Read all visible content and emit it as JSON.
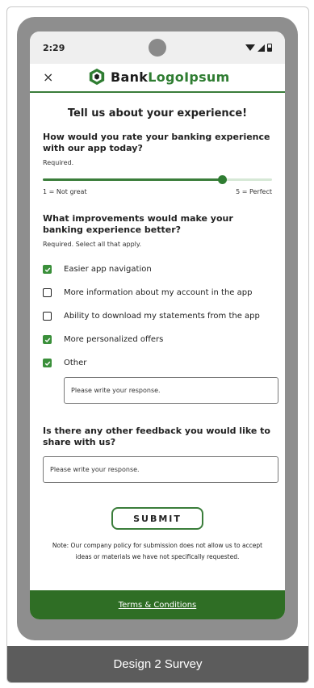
{
  "status_bar": {
    "time": "2:29"
  },
  "header": {
    "close_label": "×",
    "logo_bank": "Bank",
    "logo_rest": "LogoIpsum"
  },
  "survey": {
    "title": "Tell us about your experience!",
    "q1": {
      "title": "How would you rate your banking experience with our app today?",
      "sub": "Required.",
      "slider_value_fraction": 0.78,
      "min_label": "1 = Not great",
      "max_label": "5 = Perfect"
    },
    "q2": {
      "title": "What improvements would make your banking experience better?",
      "sub": "Required. Select all that apply.",
      "options": [
        {
          "label": "Easier app navigation",
          "checked": true
        },
        {
          "label": "More information about my account in the app",
          "checked": false
        },
        {
          "label": "Ability to download my statements from the app",
          "checked": false
        },
        {
          "label": "More personalized offers",
          "checked": true
        },
        {
          "label": "Other",
          "checked": true
        }
      ],
      "other_placeholder": "Please write your response."
    },
    "q3": {
      "title": "Is there any other feedback you would like to share with us?",
      "placeholder": "Please write your response."
    },
    "submit_label": "SUBMIT",
    "note": "Note: Our company policy for submission does not allow us to accept ideas or materials we have not specifically requested."
  },
  "footer": {
    "terms_label": "Terms & Conditions"
  },
  "caption": "Design 2 Survey",
  "colors": {
    "brand_green": "#2f7d32",
    "footer_green": "#2f6e25",
    "caption_gray": "#5c5c5c"
  },
  "icons": {
    "close": "close-icon",
    "logo": "logo-hexagon-icon",
    "wifi": "wifi-icon",
    "signal": "signal-icon",
    "battery": "battery-icon"
  }
}
